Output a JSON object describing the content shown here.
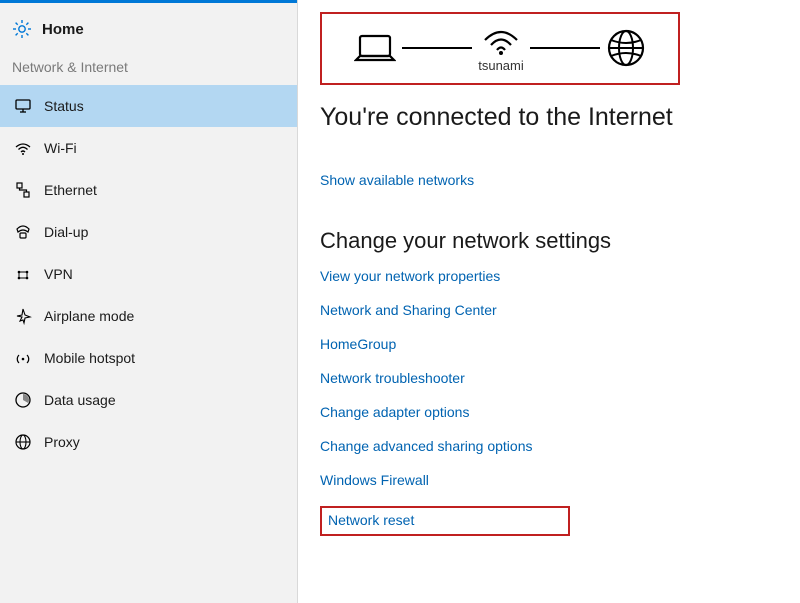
{
  "home_label": "Home",
  "section_label": "Network & Internet",
  "nav": [
    {
      "label": "Status",
      "name": "sidebar-item-status",
      "icon": "monitor"
    },
    {
      "label": "Wi-Fi",
      "name": "sidebar-item-wifi",
      "icon": "wifi"
    },
    {
      "label": "Ethernet",
      "name": "sidebar-item-ethernet",
      "icon": "ethernet"
    },
    {
      "label": "Dial-up",
      "name": "sidebar-item-dialup",
      "icon": "dialup"
    },
    {
      "label": "VPN",
      "name": "sidebar-item-vpn",
      "icon": "vpn"
    },
    {
      "label": "Airplane mode",
      "name": "sidebar-item-airplane",
      "icon": "airplane"
    },
    {
      "label": "Mobile hotspot",
      "name": "sidebar-item-mobile-hotspot",
      "icon": "hotspot"
    },
    {
      "label": "Data usage",
      "name": "sidebar-item-data-usage",
      "icon": "data"
    },
    {
      "label": "Proxy",
      "name": "sidebar-item-proxy",
      "icon": "globe-small"
    }
  ],
  "active_nav_index": 0,
  "diagram": {
    "network_name": "tsunami"
  },
  "status_title": "You're connected to the Internet",
  "show_available_label": "Show available networks",
  "change_settings_title": "Change your network settings",
  "links": [
    "View your network properties",
    "Network and Sharing Center",
    "HomeGroup",
    "Network troubleshooter",
    "Change adapter options",
    "Change advanced sharing options",
    "Windows Firewall"
  ],
  "network_reset_label": "Network reset",
  "colors": {
    "link": "#0063b1",
    "highlight": "#c02020",
    "active_bg": "#b3d7f2"
  }
}
